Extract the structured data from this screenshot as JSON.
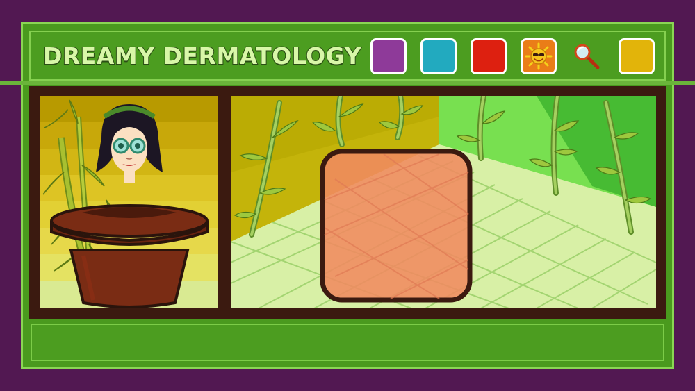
{
  "game": {
    "title": "DREAMY DERMATOLOGY"
  },
  "toolbar": {
    "swatches": [
      {
        "name": "purple",
        "color": "#8e3a99"
      },
      {
        "name": "teal",
        "color": "#22aabf"
      },
      {
        "name": "red",
        "color": "#dd2010"
      },
      {
        "name": "yellow",
        "color": "#e2b40a"
      }
    ],
    "tools": [
      {
        "name": "sun-icon"
      },
      {
        "name": "hand-mirror-icon"
      }
    ]
  },
  "scene": {
    "skin_patch_color": "#f08a60"
  }
}
